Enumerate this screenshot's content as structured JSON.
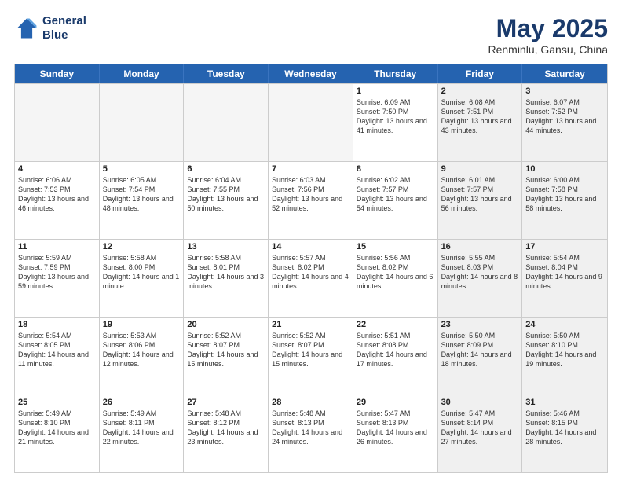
{
  "header": {
    "logo_line1": "General",
    "logo_line2": "Blue",
    "month": "May 2025",
    "location": "Renminlu, Gansu, China"
  },
  "days": [
    "Sunday",
    "Monday",
    "Tuesday",
    "Wednesday",
    "Thursday",
    "Friday",
    "Saturday"
  ],
  "rows": [
    [
      {
        "day": "",
        "empty": true
      },
      {
        "day": "",
        "empty": true
      },
      {
        "day": "",
        "empty": true
      },
      {
        "day": "",
        "empty": true
      },
      {
        "day": "1",
        "rise": "6:09 AM",
        "set": "7:50 PM",
        "daylight": "13 hours and 41 minutes."
      },
      {
        "day": "2",
        "rise": "6:08 AM",
        "set": "7:51 PM",
        "daylight": "13 hours and 43 minutes."
      },
      {
        "day": "3",
        "rise": "6:07 AM",
        "set": "7:52 PM",
        "daylight": "13 hours and 44 minutes."
      }
    ],
    [
      {
        "day": "4",
        "rise": "6:06 AM",
        "set": "7:53 PM",
        "daylight": "13 hours and 46 minutes."
      },
      {
        "day": "5",
        "rise": "6:05 AM",
        "set": "7:54 PM",
        "daylight": "13 hours and 48 minutes."
      },
      {
        "day": "6",
        "rise": "6:04 AM",
        "set": "7:55 PM",
        "daylight": "13 hours and 50 minutes."
      },
      {
        "day": "7",
        "rise": "6:03 AM",
        "set": "7:56 PM",
        "daylight": "13 hours and 52 minutes."
      },
      {
        "day": "8",
        "rise": "6:02 AM",
        "set": "7:57 PM",
        "daylight": "13 hours and 54 minutes."
      },
      {
        "day": "9",
        "rise": "6:01 AM",
        "set": "7:57 PM",
        "daylight": "13 hours and 56 minutes."
      },
      {
        "day": "10",
        "rise": "6:00 AM",
        "set": "7:58 PM",
        "daylight": "13 hours and 58 minutes."
      }
    ],
    [
      {
        "day": "11",
        "rise": "5:59 AM",
        "set": "7:59 PM",
        "daylight": "13 hours and 59 minutes."
      },
      {
        "day": "12",
        "rise": "5:58 AM",
        "set": "8:00 PM",
        "daylight": "14 hours and 1 minute."
      },
      {
        "day": "13",
        "rise": "5:58 AM",
        "set": "8:01 PM",
        "daylight": "14 hours and 3 minutes."
      },
      {
        "day": "14",
        "rise": "5:57 AM",
        "set": "8:02 PM",
        "daylight": "14 hours and 4 minutes."
      },
      {
        "day": "15",
        "rise": "5:56 AM",
        "set": "8:02 PM",
        "daylight": "14 hours and 6 minutes."
      },
      {
        "day": "16",
        "rise": "5:55 AM",
        "set": "8:03 PM",
        "daylight": "14 hours and 8 minutes."
      },
      {
        "day": "17",
        "rise": "5:54 AM",
        "set": "8:04 PM",
        "daylight": "14 hours and 9 minutes."
      }
    ],
    [
      {
        "day": "18",
        "rise": "5:54 AM",
        "set": "8:05 PM",
        "daylight": "14 hours and 11 minutes."
      },
      {
        "day": "19",
        "rise": "5:53 AM",
        "set": "8:06 PM",
        "daylight": "14 hours and 12 minutes."
      },
      {
        "day": "20",
        "rise": "5:52 AM",
        "set": "8:07 PM",
        "daylight": "14 hours and 15 minutes."
      },
      {
        "day": "21",
        "rise": "5:52 AM",
        "set": "8:07 PM",
        "daylight": "14 hours and 15 minutes."
      },
      {
        "day": "22",
        "rise": "5:51 AM",
        "set": "8:08 PM",
        "daylight": "14 hours and 17 minutes."
      },
      {
        "day": "23",
        "rise": "5:50 AM",
        "set": "8:09 PM",
        "daylight": "14 hours and 18 minutes."
      },
      {
        "day": "24",
        "rise": "5:50 AM",
        "set": "8:10 PM",
        "daylight": "14 hours and 19 minutes."
      }
    ],
    [
      {
        "day": "25",
        "rise": "5:49 AM",
        "set": "8:10 PM",
        "daylight": "14 hours and 21 minutes."
      },
      {
        "day": "26",
        "rise": "5:49 AM",
        "set": "8:11 PM",
        "daylight": "14 hours and 22 minutes."
      },
      {
        "day": "27",
        "rise": "5:48 AM",
        "set": "8:12 PM",
        "daylight": "14 hours and 23 minutes."
      },
      {
        "day": "28",
        "rise": "5:48 AM",
        "set": "8:13 PM",
        "daylight": "14 hours and 24 minutes."
      },
      {
        "day": "29",
        "rise": "5:47 AM",
        "set": "8:13 PM",
        "daylight": "14 hours and 26 minutes."
      },
      {
        "day": "30",
        "rise": "5:47 AM",
        "set": "8:14 PM",
        "daylight": "14 hours and 27 minutes."
      },
      {
        "day": "31",
        "rise": "5:46 AM",
        "set": "8:15 PM",
        "daylight": "14 hours and 28 minutes."
      }
    ]
  ]
}
